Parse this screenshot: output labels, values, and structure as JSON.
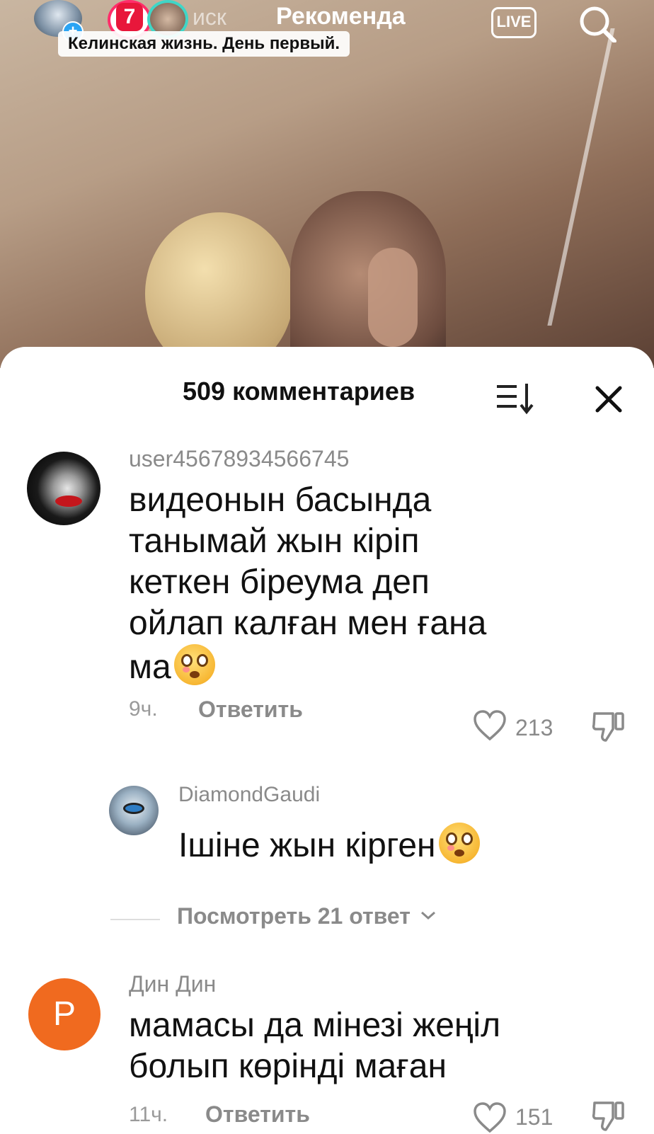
{
  "top_bar": {
    "story_number": "7",
    "tab_faded": "иск",
    "tab_active": "Рекоменда",
    "live_label": "LIVE",
    "plus_badge": "+"
  },
  "video": {
    "caption": "Келинская жизнь. День первый."
  },
  "comments_sheet": {
    "title": "509 комментариев",
    "comments": [
      {
        "username": "user45678934566745",
        "text_lines": [
          "видеонын басында",
          "танымай жын кіріп",
          "кеткен біреума деп",
          "ойлап калған мен ғана",
          "ма"
        ],
        "emoji": "flushed-face",
        "time": "9ч.",
        "reply_label": "Ответить",
        "likes": "213"
      },
      {
        "username": "DiamondGaudi",
        "text": "Ішіне жын кірген",
        "emoji": "flushed-face",
        "is_reply": true
      },
      {
        "username": "Дин Дин",
        "avatar_letter": "P",
        "avatar_color": "#f06a1f",
        "text_lines": [
          "мамасы да мінезі жеңіл",
          "болып көрінді маған"
        ],
        "time": "11ч.",
        "reply_label": "Ответить",
        "likes": "151"
      }
    ],
    "view_replies": "Посмотреть 21 ответ"
  }
}
